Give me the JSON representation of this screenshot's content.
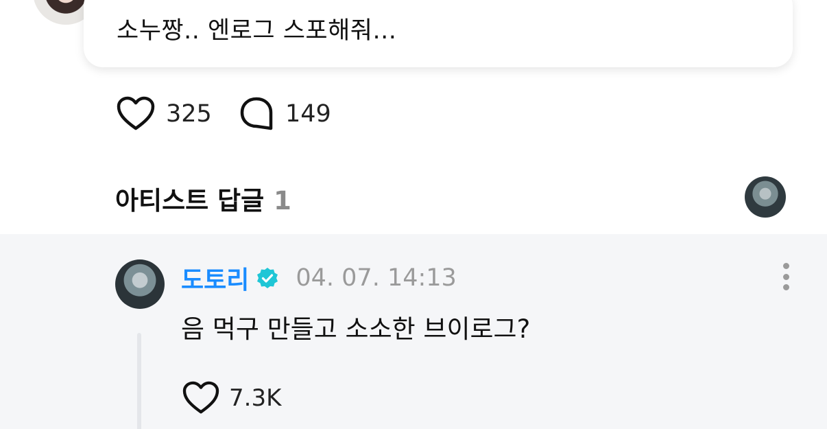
{
  "post": {
    "text": "소누짱.. 엔로그 스포해줘...",
    "likes": "325",
    "comments": "149"
  },
  "artist_replies": {
    "title": "아티스트 답글",
    "count": "1"
  },
  "reply": {
    "author": "도토리",
    "verified": true,
    "timestamp": "04. 07. 14:13",
    "text": "음 먹구 만들고 소소한 브이로그?",
    "likes": "7.3K"
  },
  "colors": {
    "author_blue": "#1a8cff",
    "verified_cyan": "#1fc6d6",
    "reply_background": "#f5f6f8"
  }
}
